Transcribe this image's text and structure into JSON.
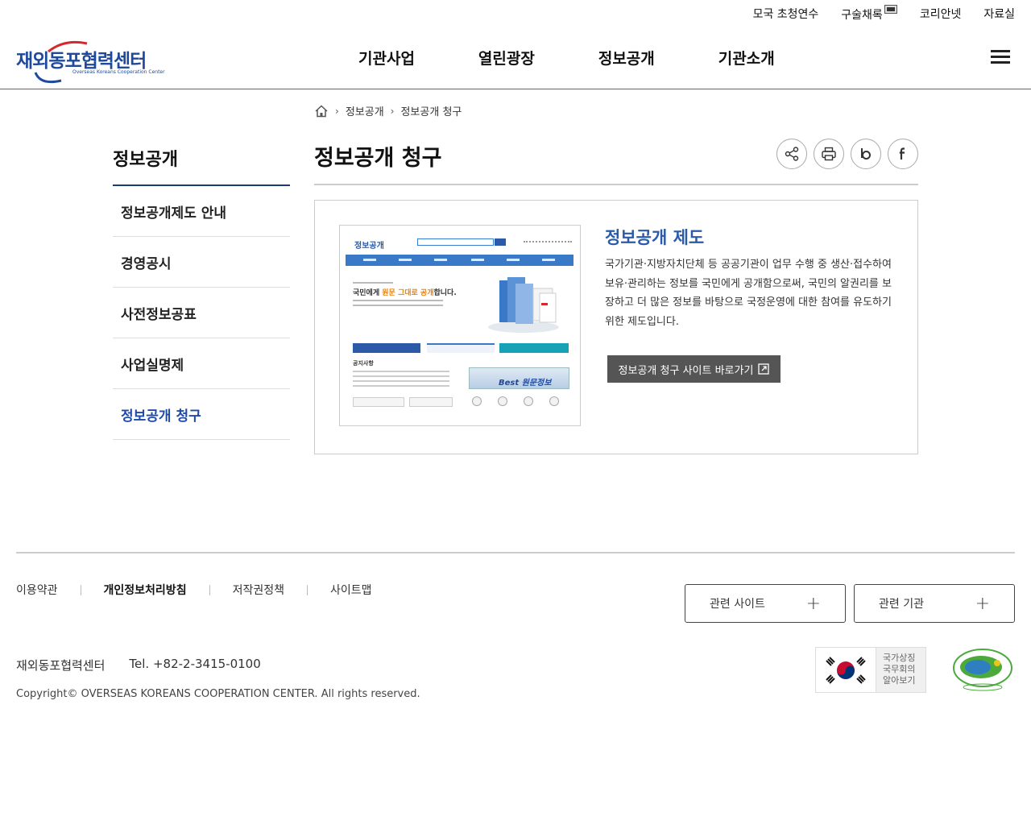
{
  "util_links": [
    "모국 초청연수",
    "구술채록",
    "코리안넷",
    "자료실"
  ],
  "logo": {
    "kor": "재외동포협력센터",
    "eng": "Overseas Koreans Cooperation Center"
  },
  "gnb": [
    "기관사업",
    "열린광장",
    "정보공개",
    "기관소개"
  ],
  "breadcrumb": {
    "level1": "정보공개",
    "level2": "정보공개 청구"
  },
  "lnb": {
    "title": "정보공개",
    "items": [
      "정보공개제도 안내",
      "경영공시",
      "사전정보공표",
      "사업실명제",
      "정보공개 청구"
    ]
  },
  "page": {
    "title": "정보공개 청구"
  },
  "content": {
    "heading": "정보공개 제도",
    "description": "국가기관·지방자치단체 등 공공기관이 업무 수행 중 생산·접수하여 보유·관리하는 정보를 국민에게 공개함으로써, 국민의 알권리를 보장하고 더 많은 정보를 바탕으로 국정운영에 대한 참여를 유도하기 위한 제도입니다.",
    "button": "정보공개 청구 사이트 바로가기",
    "mock": {
      "logo": "정보공개",
      "hero_plain1": "국민에게 ",
      "hero_hl": "원문 그대로 공개",
      "hero_plain2": "합니다.",
      "list_title": "공지사항",
      "best": "Best 원문정보"
    }
  },
  "footer": {
    "links": [
      "이용약관",
      "개인정보처리방침",
      "저작권정책",
      "사이트맵"
    ],
    "related_site": "관련 사이트",
    "related_org": "관련 기관",
    "org_name": "재외동포협력센터",
    "tel": "Tel. +82-2-3415-0100",
    "copyright": "Copyright© OVERSEAS KOREANS COOPERATION CENTER. All rights reserved.",
    "gov_badge": [
      "국가상징",
      "국무회의",
      "알아보기"
    ]
  },
  "colors": {
    "accent": "#1f4aa8",
    "heading_blue": "#2a5aa8",
    "button_gray": "#555555"
  }
}
